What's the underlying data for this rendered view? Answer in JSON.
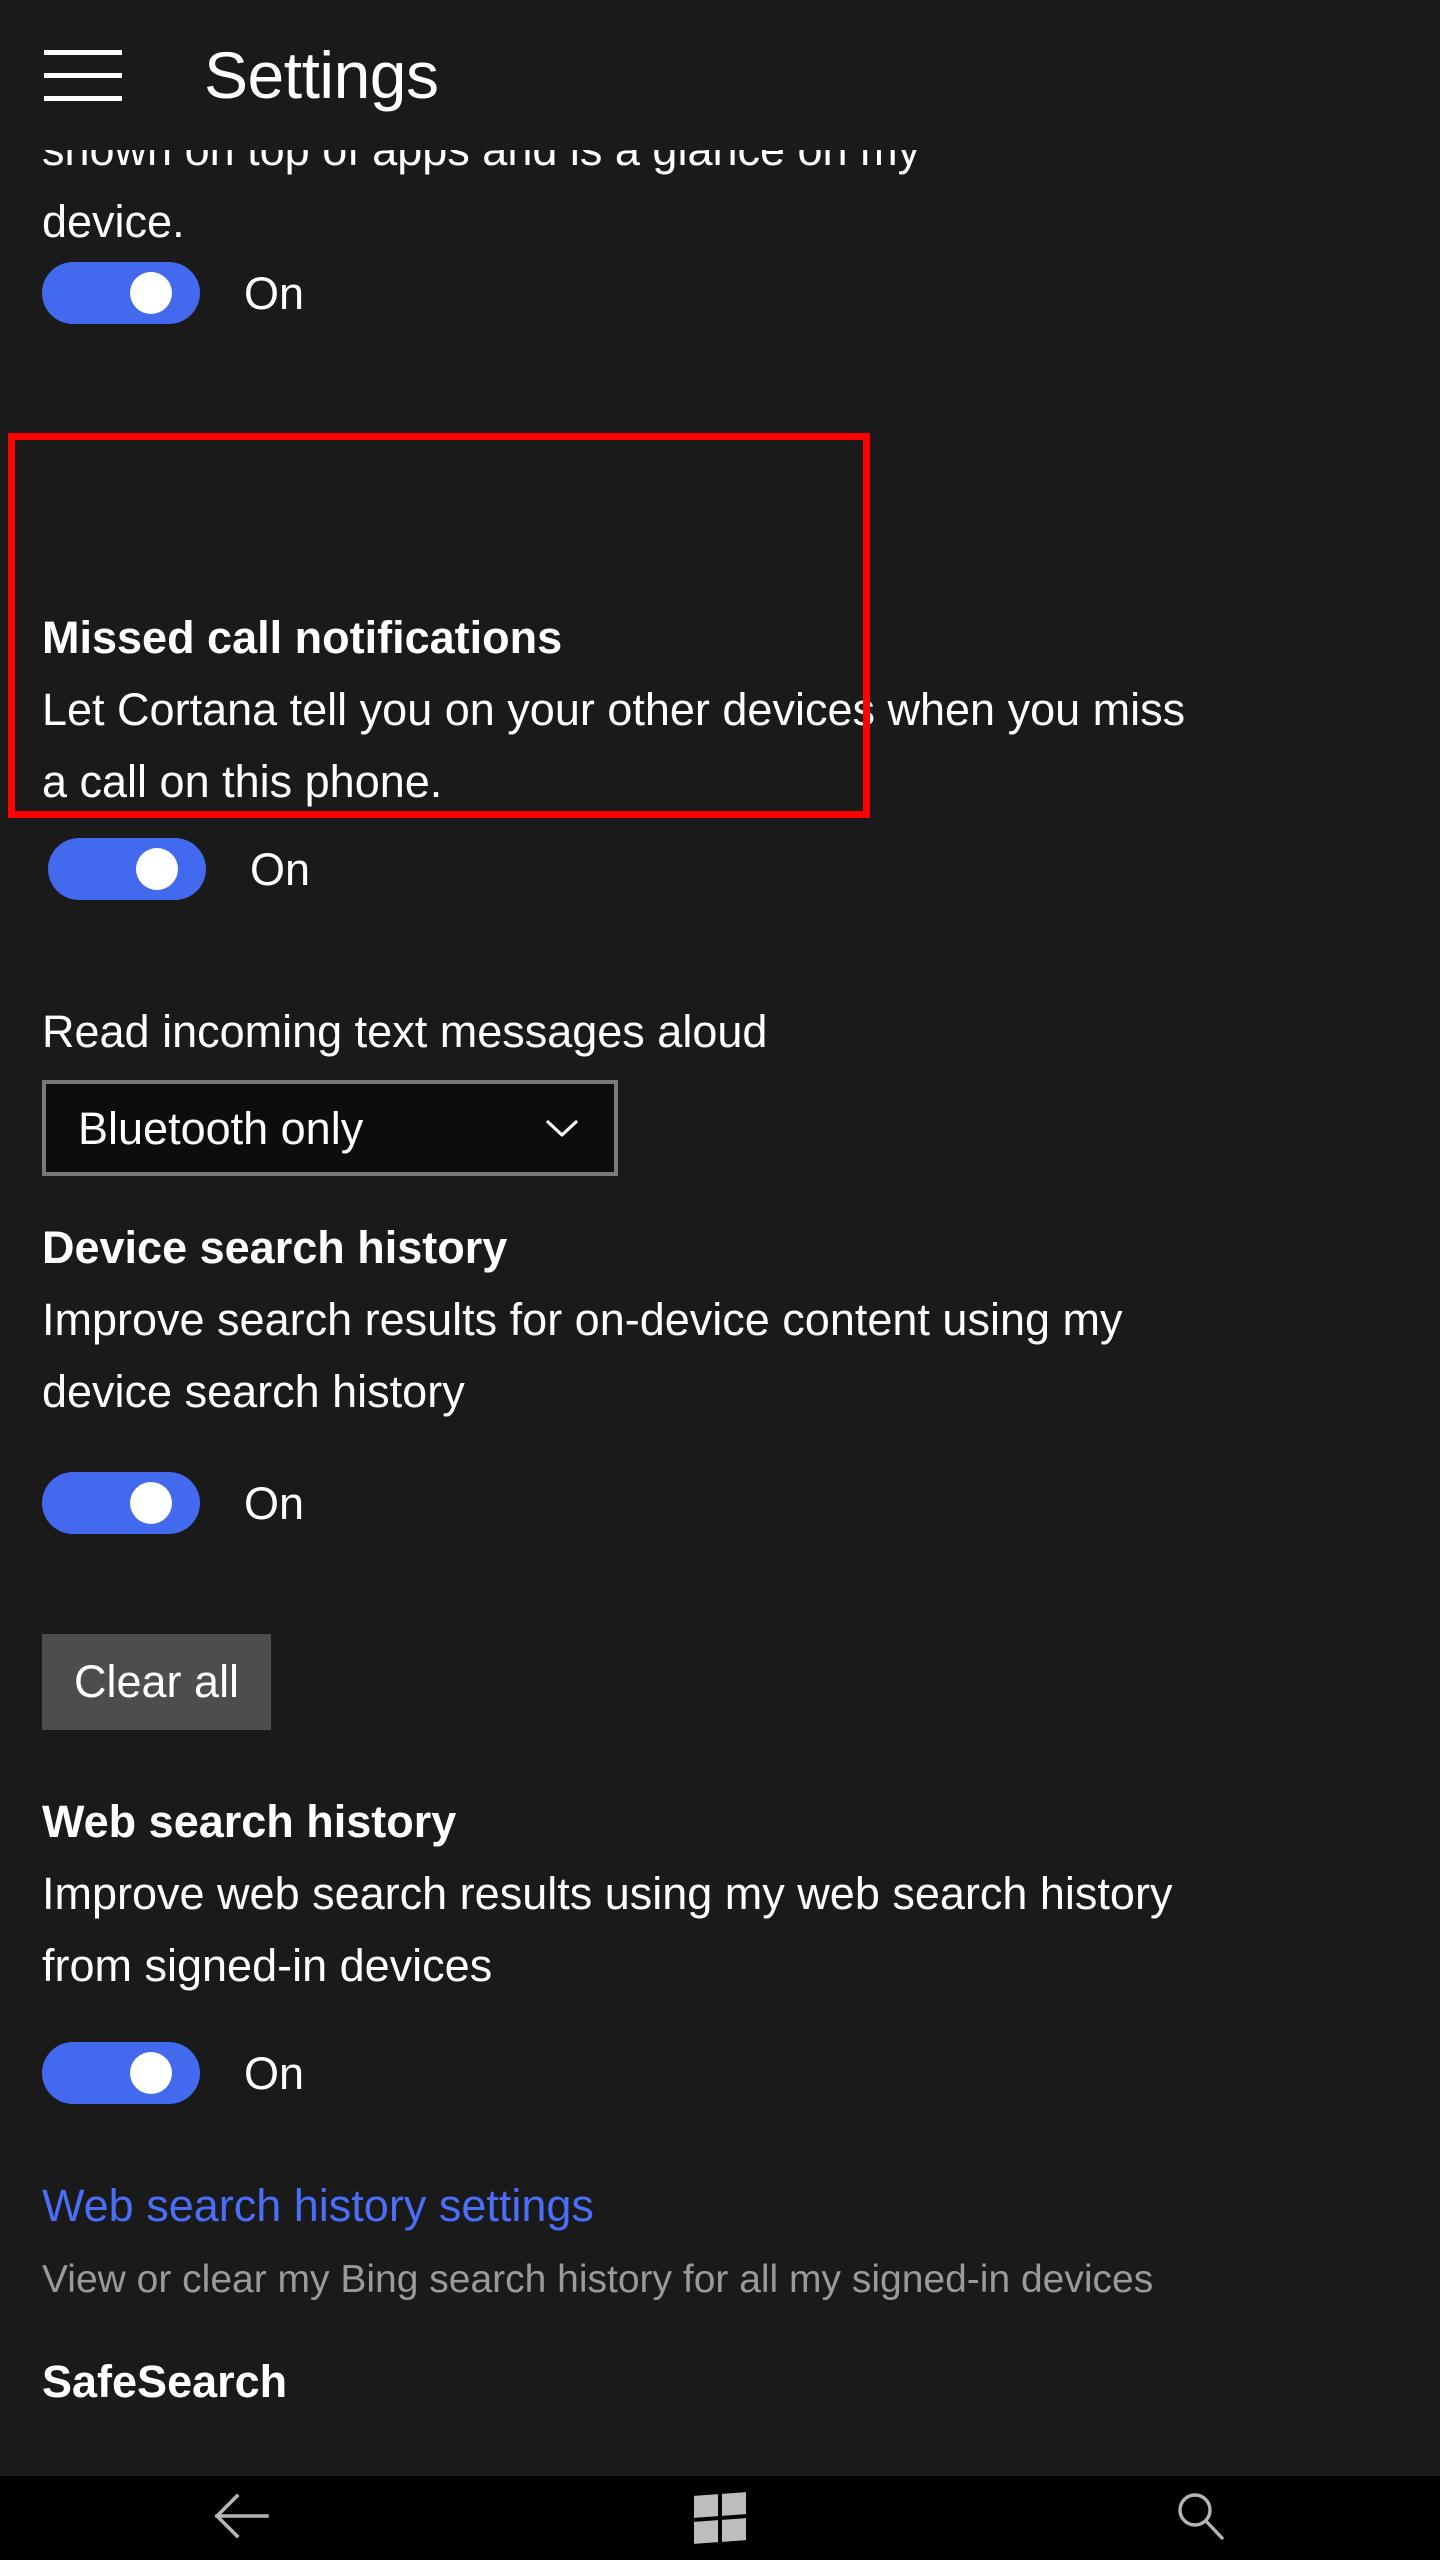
{
  "header": {
    "title": "Settings",
    "menu_icon": "hamburger-menu-icon"
  },
  "scrolled_partial_text": {
    "cut_off_line": "shown on top of apps and is a glance on my",
    "visible_line": "device."
  },
  "toggles": {
    "on_label": "On"
  },
  "sections": [
    {
      "id": "top-clipped-toggle",
      "toggle_state": "On"
    },
    {
      "id": "missed-call-notifications",
      "title": "Missed call notifications",
      "description": "Let Cortana tell you on your other devices when you miss a call on this phone.",
      "description_line1": "Let Cortana tell you on your other devices when you miss",
      "description_line2": "a call on this phone.",
      "toggle_state": "On",
      "highlighted": true,
      "highlight_color": "#ff0000"
    },
    {
      "id": "read-incoming-text-messages-aloud",
      "label": "Read incoming text messages aloud",
      "dropdown_value": "Bluetooth only",
      "dropdown_icon": "chevron-down-icon"
    },
    {
      "id": "device-search-history",
      "title": "Device search history",
      "description_line1": "Improve search results for on-device content using my",
      "description_line2": "device search history",
      "toggle_state": "On",
      "button_label": "Clear all"
    },
    {
      "id": "web-search-history",
      "title": "Web search history",
      "description_line1": "Improve web search results using my web search history",
      "description_line2": "from signed-in devices",
      "toggle_state": "On"
    },
    {
      "id": "web-search-history-settings",
      "link_label": "Web search history settings",
      "sub_label": "View or clear my Bing search history for all my signed-in devices"
    },
    {
      "id": "safesearch",
      "title": "SafeSearch"
    }
  ],
  "navbar": {
    "back_icon": "back-arrow-icon",
    "home_icon": "windows-logo-icon",
    "search_icon": "search-icon"
  },
  "colors": {
    "background": "#1a1a1a",
    "toggle_on": "#4369ef",
    "link": "#4a6ef7",
    "highlight": "#ff0000",
    "button": "#4d4d4d",
    "navbar": "#000000",
    "subtext": "#9a9a9a"
  }
}
